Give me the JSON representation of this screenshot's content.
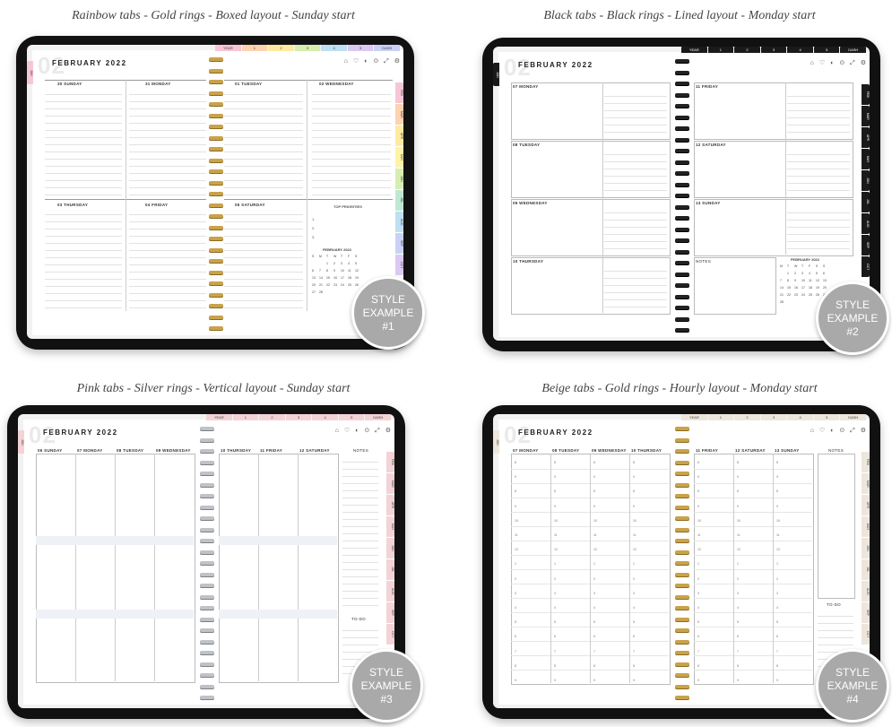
{
  "examples": [
    {
      "caption": "Rainbow tabs - Gold rings - Boxed layout - Sunday start",
      "month_title": "FEBRUARY 2022",
      "big_number": "02",
      "icons": "⌂ ♡ ◐ ⊙ ⤢ ⚙",
      "top_tabs": [
        "YEAR",
        "1",
        "2",
        "3",
        "4",
        "5",
        "DASH"
      ],
      "side_tabs": [
        "FEB",
        "MAR",
        "APR",
        "MAY",
        "JUN",
        "JUL",
        "AUG",
        "SEP",
        "OCT"
      ],
      "left_tab": "JAN",
      "days_left": [
        "30 SUNDAY",
        "31 MONDAY",
        "03 THURSDAY",
        "04 FRIDAY"
      ],
      "days_right": [
        "01 TUESDAY",
        "02 WEDNESDAY",
        "05 SATURDAY"
      ],
      "priorities_title": "TOP PRIORITIES",
      "priorities": [
        "1.",
        "2.",
        "3."
      ],
      "mini_cal_title": "FEBRUARY 2022",
      "mini_cal": [
        "S",
        "M",
        "T",
        "W",
        "T",
        "F",
        "S",
        "",
        "",
        "1",
        "2",
        "3",
        "4",
        "5",
        "6",
        "7",
        "8",
        "9",
        "10",
        "11",
        "12",
        "13",
        "14",
        "15",
        "16",
        "17",
        "18",
        "19",
        "20",
        "21",
        "22",
        "23",
        "24",
        "25",
        "26",
        "27",
        "28"
      ],
      "badge": [
        "STYLE",
        "EXAMPLE",
        "#1"
      ]
    },
    {
      "caption": "Black tabs - Black rings - Lined layout - Monday start",
      "month_title": "FEBRUARY 2022",
      "big_number": "02",
      "icons": "⌂ ♡ ◐ ⊙ ⤢ ⚙",
      "top_tabs": [
        "YEAR",
        "1",
        "2",
        "3",
        "4",
        "5",
        "DASH"
      ],
      "side_tabs": [
        "FEB",
        "MAR",
        "APR",
        "MAY",
        "JUN",
        "JUL",
        "AUG",
        "SEP",
        "OCT"
      ],
      "left_tab": "JAN",
      "days_left": [
        "07 MONDAY",
        "08 TUESDAY",
        "09 WEDNESDAY",
        "10 THURSDAY"
      ],
      "days_right": [
        "11 FRIDAY",
        "12 SATURDAY",
        "13 SUNDAY"
      ],
      "notes": "NOTES",
      "mini_cal_title": "FEBRUARY 2022",
      "mini_cal": [
        "M",
        "T",
        "W",
        "T",
        "F",
        "S",
        "S",
        "",
        "1",
        "2",
        "3",
        "4",
        "5",
        "6",
        "7",
        "8",
        "9",
        "10",
        "11",
        "12",
        "13",
        "14",
        "15",
        "16",
        "17",
        "18",
        "19",
        "20",
        "21",
        "22",
        "23",
        "24",
        "25",
        "26",
        "27",
        "28"
      ],
      "badge": [
        "STYLE",
        "EXAMPLE",
        "#2"
      ]
    },
    {
      "caption": "Pink tabs - Silver rings - Vertical layout - Sunday start",
      "month_title": "FEBRUARY 2022",
      "big_number": "02",
      "icons": "⌂ ♡ ◐ ⊙ ⤢ ⚙",
      "top_tabs": [
        "YEAR",
        "1",
        "2",
        "3",
        "4",
        "5",
        "DASH"
      ],
      "side_tabs": [
        "FEB",
        "MAR",
        "APR",
        "MAY",
        "JUN",
        "JUL",
        "AUG",
        "SEP",
        "OCT"
      ],
      "left_tab": "JAN",
      "days_left": [
        "06 SUNDAY",
        "07 MONDAY",
        "08 TUESDAY",
        "09 WEDNESDAY"
      ],
      "days_right": [
        "10 THURSDAY",
        "11 FRIDAY",
        "12 SATURDAY"
      ],
      "notes": "NOTES",
      "todo": "TO-DO",
      "badge": [
        "STYLE",
        "EXAMPLE",
        "#3"
      ]
    },
    {
      "caption": "Beige tabs - Gold rings - Hourly layout - Monday start",
      "month_title": "FEBRUARY 2022",
      "big_number": "02",
      "icons": "⌂ ♡ ◐ ⊙ ⤢ ⚙",
      "top_tabs": [
        "YEAR",
        "1",
        "2",
        "3",
        "4",
        "5",
        "DASH"
      ],
      "side_tabs": [
        "FEB",
        "MAR",
        "APR",
        "MAY",
        "JUN",
        "JUL",
        "AUG",
        "SEP",
        "OCT"
      ],
      "left_tab": "JAN",
      "days_left": [
        "07 MONDAY",
        "08 TUESDAY",
        "09 WEDNESDAY",
        "10 THURSDAY"
      ],
      "days_right": [
        "11 FRIDAY",
        "12 SATURDAY",
        "13 SUNDAY"
      ],
      "notes": "NOTES",
      "todo": "TO-DO",
      "hours": [
        "8",
        "9",
        "8",
        "9",
        "10",
        "11",
        "12",
        "1",
        "2",
        "3",
        "4",
        "5",
        "6",
        "7",
        "8",
        "9"
      ],
      "badge": [
        "STYLE",
        "EXAMPLE",
        "#4"
      ]
    }
  ],
  "colors": {
    "rainbow": [
      "#f7c6d6",
      "#ffd2b0",
      "#ffeaa0",
      "#fff3a6",
      "#d6eeb0",
      "#bfe8d4",
      "#bde0f2",
      "#c9d2f6",
      "#dcc9f2"
    ],
    "black": "#1a1a1a",
    "pink": "#f3d3d6",
    "beige": "#ede6dc",
    "badge": "#a9a9a9"
  }
}
